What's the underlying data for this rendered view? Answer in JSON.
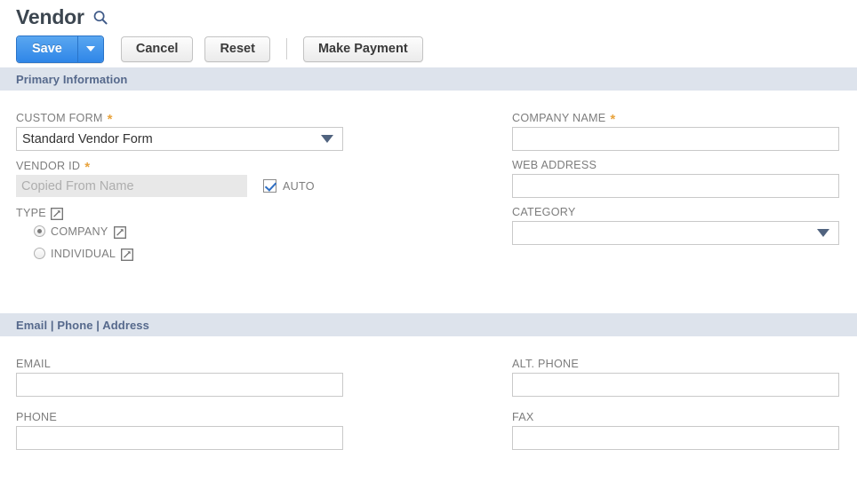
{
  "header": {
    "title": "Vendor",
    "search_icon": "search-icon"
  },
  "toolbar": {
    "save_label": "Save",
    "save_dropdown_icon": "chevron-down-icon",
    "cancel_label": "Cancel",
    "reset_label": "Reset",
    "make_payment_label": "Make Payment"
  },
  "sections": [
    {
      "title": "Primary Information"
    },
    {
      "title": "Email | Phone | Address"
    }
  ],
  "primary_information": {
    "custom_form": {
      "label": "CUSTOM FORM",
      "required": "*",
      "value": "Standard Vendor Form",
      "caret_icon": "chevron-down-icon"
    },
    "vendor_id": {
      "label": "VENDOR ID",
      "required": "*",
      "placeholder": "Copied From Name",
      "value": ""
    },
    "auto": {
      "label": "AUTO",
      "checked": true
    },
    "type": {
      "label": "TYPE",
      "popup_icon": "open-in-new-window-icon",
      "options": [
        {
          "label": "COMPANY",
          "selected": true,
          "popup_icon": "open-in-new-window-icon"
        },
        {
          "label": "INDIVIDUAL",
          "selected": false,
          "popup_icon": "open-in-new-window-icon"
        }
      ]
    },
    "company_name": {
      "label": "COMPANY NAME",
      "required": "*",
      "value": "",
      "placeholder": ""
    },
    "web_address": {
      "label": "WEB ADDRESS",
      "value": "",
      "placeholder": ""
    },
    "category": {
      "label": "CATEGORY",
      "value": "",
      "caret_icon": "chevron-down-icon"
    }
  },
  "email_phone_address": {
    "email": {
      "label": "EMAIL",
      "value": "",
      "placeholder": ""
    },
    "phone": {
      "label": "PHONE",
      "value": "",
      "placeholder": ""
    },
    "alt_phone": {
      "label": "ALT. PHONE",
      "value": "",
      "placeholder": ""
    },
    "fax": {
      "label": "FAX",
      "value": "",
      "placeholder": ""
    }
  },
  "colors": {
    "primary_button": "#2f86e8",
    "section_header_bg": "#dde3ec",
    "section_header_text": "#56698c",
    "title_text": "#3c4650",
    "label_text": "#7d7d7d",
    "required_asterisk": "#e8a33d",
    "input_border": "#c9c9c9",
    "readonly_bg": "#e8e8e8"
  }
}
